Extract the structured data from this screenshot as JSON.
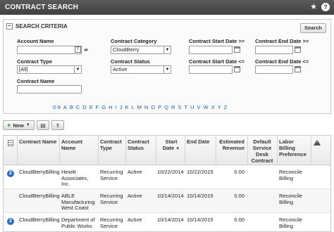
{
  "window": {
    "title": "CONTRACT SEARCH"
  },
  "criteria": {
    "title": "SEARCH CRITERIA",
    "search_label": "Search",
    "account_name": {
      "label": "Account Name",
      "value": ""
    },
    "contract_category": {
      "label": "Contract Category",
      "value": "CloudBerry"
    },
    "contract_start_gte": {
      "label": "Contract Start Date >=",
      "value": ""
    },
    "contract_end_gte": {
      "label": "Contract End Date >=",
      "value": ""
    },
    "contract_type": {
      "label": "Contract Type",
      "value": "[All]"
    },
    "contract_status": {
      "label": "Contract Status",
      "value": "Active"
    },
    "contract_start_lte": {
      "label": "Contract Start Date <=",
      "value": ""
    },
    "contract_end_lte": {
      "label": "Contract End Date <=",
      "value": ""
    },
    "contract_name": {
      "label": "Contract Name",
      "value": ""
    }
  },
  "alphabet": [
    "0-9",
    "A",
    "B",
    "C",
    "D",
    "E",
    "F",
    "G",
    "H",
    "I",
    "J",
    "K",
    "L",
    "M",
    "N",
    "O",
    "P",
    "Q",
    "R",
    "S",
    "T",
    "U",
    "V",
    "W",
    "X",
    "Y",
    "Z"
  ],
  "toolbar": {
    "new_label": "New"
  },
  "grid": {
    "columns": [
      "Contract Name",
      "Account Name",
      "Contract Type",
      "Contract Status",
      "Start Date",
      "End Date",
      "Estimated Revenue",
      "Default Service Desk Contract",
      "Labor Billing Preference"
    ],
    "sort_indicator": "▼",
    "rows": [
      {
        "badge": "2",
        "contract_name": "CloudBerryBilling",
        "account_name": "Hewitt Associates, Inc.",
        "contract_type": "Recurring Service",
        "status": "Active",
        "start": "10/22/2014",
        "end": "10/22/2015",
        "revenue": "0.00",
        "labor": "Reconcile Billing"
      },
      {
        "badge": "",
        "contract_name": "CloudBerryBilling",
        "account_name": "ABLE Manufacturing West Coast",
        "contract_type": "Recurring Service",
        "status": "Active",
        "start": "10/14/2014",
        "end": "10/14/2015",
        "revenue": "0.00",
        "labor": "Reconcile Billing"
      },
      {
        "badge": "2",
        "contract_name": "CloudBerryBilling",
        "account_name": "Department of Public Works",
        "contract_type": "Recurring Service",
        "status": "Active",
        "start": "10/14/2014",
        "end": "10/14/2015",
        "revenue": "0.00",
        "labor": "Reconcile Billing"
      }
    ]
  },
  "colors": {
    "titlebar": "#4a4a4a",
    "link": "#1a5dad",
    "badge": "#2d6cc0"
  }
}
